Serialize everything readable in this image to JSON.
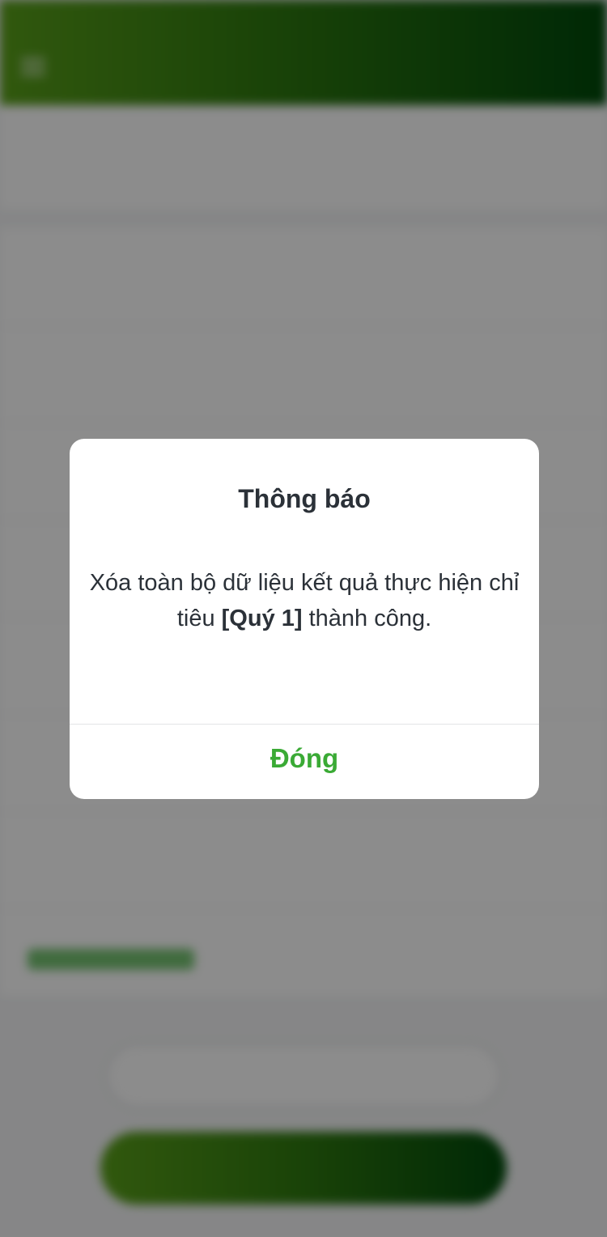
{
  "dialog": {
    "title": "Thông báo",
    "message_part1": "Xóa toàn bộ dữ liệu kết quả thực hiện chỉ tiêu ",
    "message_highlight": "[Quý 1]",
    "message_part2": " thành công.",
    "button_label": "Đóng"
  },
  "colors": {
    "accent_green": "#3aaa35",
    "header_gradient_start": "#5aa11a",
    "header_gradient_end": "#004a0a",
    "dialog_text": "#2b3138"
  }
}
